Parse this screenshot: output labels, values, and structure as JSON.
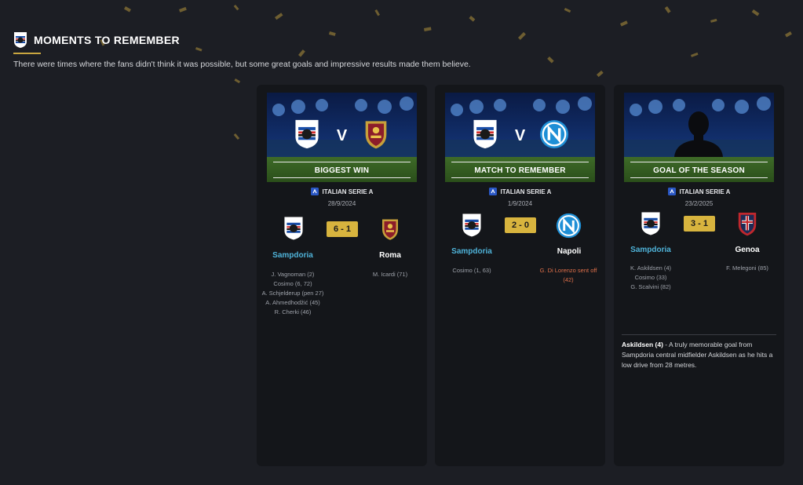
{
  "header": {
    "title": "MOMENTS TO REMEMBER",
    "subtitle": "There were times where the fans didn't think it was possible, but some great goals and impressive results made them believe."
  },
  "colors": {
    "accent_gold": "#d8b43e",
    "home_team_blue": "#4fb3d9",
    "sent_off_red": "#e0704a",
    "card_bg": "#14161a",
    "page_bg": "#1c1e24"
  },
  "cards": [
    {
      "banner_label": "BIGGEST WIN",
      "banner_vs": "V",
      "competition": "ITALIAN SERIE A",
      "date": "28/9/2024",
      "score": "6 - 1",
      "home": {
        "name": "Sampdoria",
        "crest": "sampdoria-crest-icon",
        "scorers": [
          "J. Vagnoman (2)",
          "Cosimo (6, 72)",
          "A. Schjelderup (pen 27)",
          "A. Ahmedhodžić (45)",
          "R. Cherki (46)"
        ]
      },
      "away": {
        "name": "Roma",
        "crest": "roma-crest-icon",
        "scorers": [
          "M. Icardi (71)"
        ]
      }
    },
    {
      "banner_label": "MATCH TO REMEMBER",
      "banner_vs": "V",
      "competition": "ITALIAN SERIE A",
      "date": "1/9/2024",
      "score": "2 - 0",
      "home": {
        "name": "Sampdoria",
        "crest": "sampdoria-crest-icon",
        "scorers": [
          "Cosimo (1, 63)"
        ]
      },
      "away": {
        "name": "Napoli",
        "crest": "napoli-crest-icon",
        "scorers": [
          "G. Di Lorenzo sent off (42)"
        ]
      }
    },
    {
      "banner_label": "GOAL OF THE SEASON",
      "competition": "ITALIAN SERIE A",
      "date": "23/2/2025",
      "score": "3 - 1",
      "home": {
        "name": "Sampdoria",
        "crest": "sampdoria-crest-icon",
        "scorers": [
          "K. Askildsen (4)",
          "Cosimo (33)",
          "G. Scalvini (82)"
        ]
      },
      "away": {
        "name": "Genoa",
        "crest": "genoa-crest-icon",
        "scorers": [
          "F. Melegoni (85)"
        ]
      },
      "description_lead": "Askildsen (4)",
      "description": " - A truly memorable goal from Sampdoria central midfielder Askildsen as he hits a low drive from 28 metres."
    }
  ]
}
